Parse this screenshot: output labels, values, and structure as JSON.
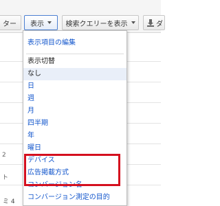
{
  "toolbar": {
    "left_partial_label": "ター",
    "view_button_label": "表示",
    "search_query_button_label": "検索クエリーを表示",
    "download_partial_label": "ダ"
  },
  "menu": {
    "edit_columns": "表示項目の編集",
    "segment_heading": "表示切替",
    "items": [
      {
        "label": "なし"
      },
      {
        "label": "日"
      },
      {
        "label": "週"
      },
      {
        "label": "月"
      },
      {
        "label": "四半期"
      },
      {
        "label": "年"
      },
      {
        "label": "曜日"
      },
      {
        "label": "デバイス"
      },
      {
        "label": "広告掲載方式"
      },
      {
        "label": "コンバージョン名"
      },
      {
        "label": "コンバージョン測定の目的"
      }
    ]
  },
  "page": {
    "side_marks": [
      "2",
      "ト"
    ],
    "bottom_text": "ミ 4"
  },
  "colors": {
    "link": "#1155cc",
    "highlight": "#d40f1e",
    "selected_bg": "#e9eff9"
  }
}
